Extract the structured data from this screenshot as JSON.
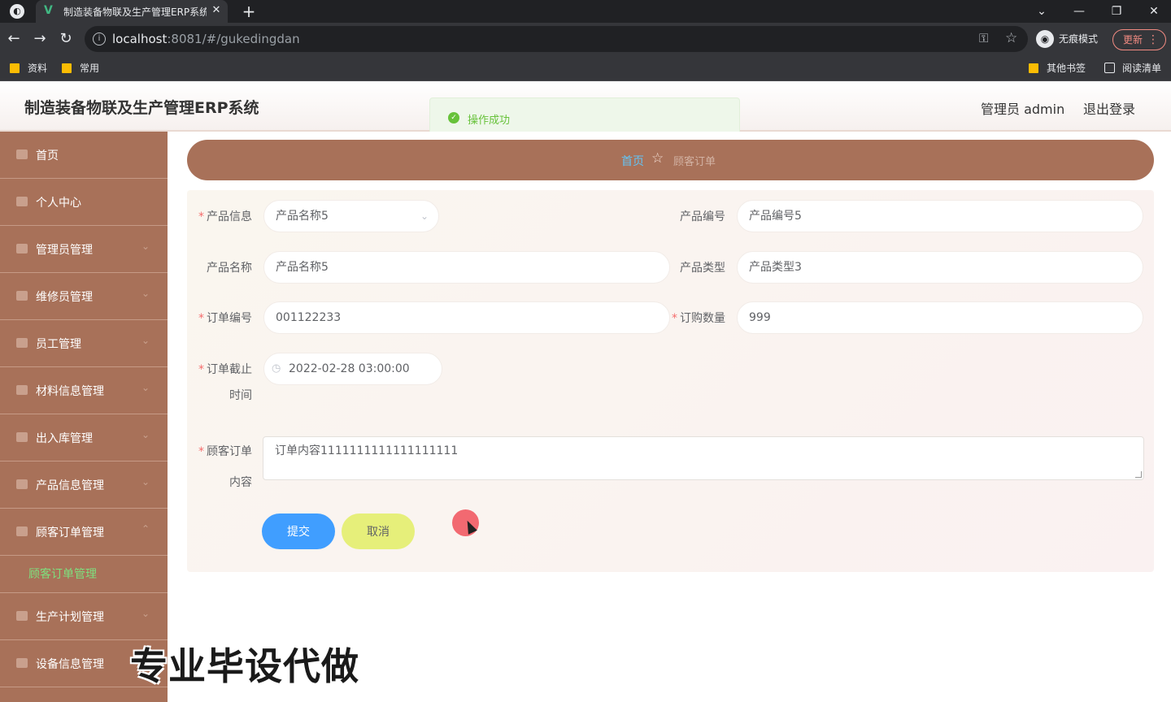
{
  "browser": {
    "tab_title": "制造装备物联及生产管理ERP系统",
    "url_host": "localhost",
    "url_rest": ":8081/#/gukedingdan",
    "incognito_label": "无痕模式",
    "update_label": "更新",
    "bookmarks": [
      "资料",
      "常用"
    ],
    "bookmarks_right": [
      "其他书签",
      "阅读清单"
    ]
  },
  "header": {
    "title": "制造装备物联及生产管理ERP系统",
    "user_label": "管理员 admin",
    "logout_label": "退出登录"
  },
  "toast": {
    "message": "操作成功",
    "color": "#67c23a"
  },
  "sidebar": {
    "items": [
      {
        "label": "首页"
      },
      {
        "label": "个人中心"
      },
      {
        "label": "管理员管理"
      },
      {
        "label": "维修员管理"
      },
      {
        "label": "员工管理"
      },
      {
        "label": "材料信息管理"
      },
      {
        "label": "出入库管理"
      },
      {
        "label": "产品信息管理"
      },
      {
        "label": "顾客订单管理"
      },
      {
        "label": "生产计划管理"
      },
      {
        "label": "设备信息管理"
      }
    ],
    "active_sub": "顾客订单管理",
    "bg_color": "#a87159"
  },
  "breadcrumb": {
    "home": "首页",
    "current": "顾客订单"
  },
  "form": {
    "product_info": {
      "label": "产品信息",
      "value": "产品名称5"
    },
    "product_code": {
      "label": "产品编号",
      "value": "产品编号5"
    },
    "product_name": {
      "label": "产品名称",
      "value": "产品名称5"
    },
    "product_type": {
      "label": "产品类型",
      "value": "产品类型3"
    },
    "order_no": {
      "label": "订单编号",
      "value": "001122233"
    },
    "order_qty": {
      "label": "订购数量",
      "value": "999"
    },
    "deadline": {
      "label_1": "订单截止",
      "label_2": "时间",
      "value": "2022-02-28 03:00:00"
    },
    "content": {
      "label_1": "顾客订单",
      "label_2": "内容",
      "value": "订单内容1111111111111111111"
    },
    "submit_label": "提交",
    "cancel_label": "取消"
  },
  "watermark": "专业毕设代做"
}
